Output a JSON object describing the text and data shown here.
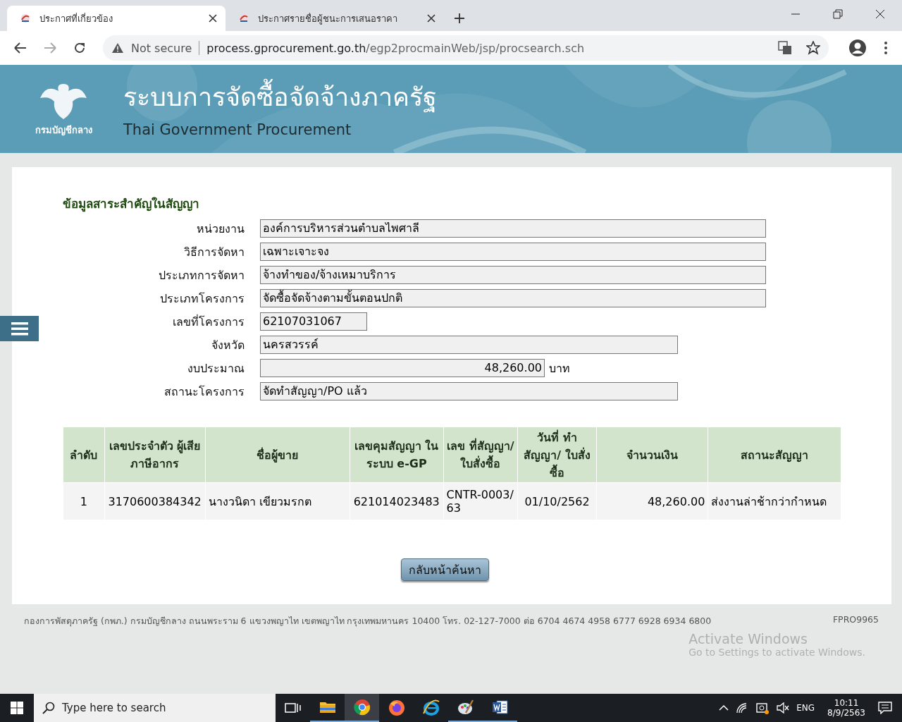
{
  "browser": {
    "tabs": [
      {
        "title": "ประกาศที่เกี่ยวข้อง",
        "selected": true
      },
      {
        "title": "ประกาศรายชื่อผู้ชนะการเสนอราคา",
        "selected": false
      }
    ],
    "address": {
      "security": "Not secure",
      "host": "process.gprocurement.go.th",
      "path": "/egp2procmainWeb/jsp/procsearch.sch"
    }
  },
  "banner": {
    "title": "ระบบการจัดซื้อจัดจ้างภาครัฐ",
    "subtitle": "Thai Government Procurement",
    "logo_text": "กรมบัญชีกลาง"
  },
  "section_title": "ข้อมูลสาระสำคัญในสัญญา",
  "fields": [
    {
      "label": "หน่วยงาน",
      "value": "องค์การบริหารส่วนตำบลไพศาลี",
      "kind": "wide"
    },
    {
      "label": "วิธีการจัดหา",
      "value": "เฉพาะเจาะจง",
      "kind": "wide"
    },
    {
      "label": "ประเภทการจัดหา",
      "value": "จ้างทำของ/จ้างเหมาบริการ",
      "kind": "wide"
    },
    {
      "label": "ประเภทโครงการ",
      "value": "จัดซื้อจัดจ้างตามขั้นตอนปกติ",
      "kind": "wide"
    },
    {
      "label": "เลขที่โครงการ",
      "value": "62107031067",
      "kind": "short"
    },
    {
      "label": "จังหวัด",
      "value": "นครสวรรค์",
      "kind": "medium"
    },
    {
      "label": "งบประมาณ",
      "value": "48,260.00",
      "kind": "money",
      "unit": "บาท"
    },
    {
      "label": "สถานะโครงการ",
      "value": "จัดทำสัญญา/PO แล้ว",
      "kind": "medium"
    }
  ],
  "table": {
    "columns": [
      "ลำดับ",
      "เลขประจำตัว ผู้เสียภาษีอากร",
      "ชื่อผู้ขาย",
      "เลขคุมสัญญา ในระบบ e-GP",
      "เลข ที่สัญญา/ ใบสั่งซื้อ",
      "วันที่ ทำสัญญา/ ใบสั่งซื้อ",
      "จำนวนเงิน",
      "สถานะสัญญา"
    ],
    "rows": [
      [
        "1",
        "3170600384342",
        "นางวนิดา เขียวมรกต",
        "621014023483",
        "CNTR-0003/63",
        "01/10/2562",
        "48,260.00",
        "ส่งงานล่าช้ากว่ากำหนด"
      ]
    ]
  },
  "back_button": "กลับหน้าค้นหา",
  "footer": {
    "text": "กองการพัสดุภาครัฐ (กพภ.) กรมบัญชีกลาง ถนนพระราม 6 แขวงพญาไท เขตพญาไท กรุงเทพมหานคร 10400 โทร. 02-127-7000 ต่อ 6704 4674 4958 6777 6928 6934 6800",
    "code": "FPRO9965"
  },
  "activation": {
    "title": "Activate Windows",
    "text": "Go to Settings to activate Windows."
  },
  "taskbar": {
    "search_placeholder": "Type here to search",
    "apps": [
      {
        "kind": "taskview",
        "open": false,
        "selected": false
      },
      {
        "kind": "folder",
        "open": true,
        "selected": false
      },
      {
        "kind": "chrome",
        "open": true,
        "selected": true
      },
      {
        "kind": "firefox",
        "open": false,
        "selected": false
      },
      {
        "kind": "ie",
        "open": false,
        "selected": false
      },
      {
        "kind": "paint",
        "open": true,
        "selected": false
      },
      {
        "kind": "word",
        "open": true,
        "selected": false
      }
    ],
    "language": "ENG",
    "time": "10:11",
    "date": "8/9/2563"
  }
}
